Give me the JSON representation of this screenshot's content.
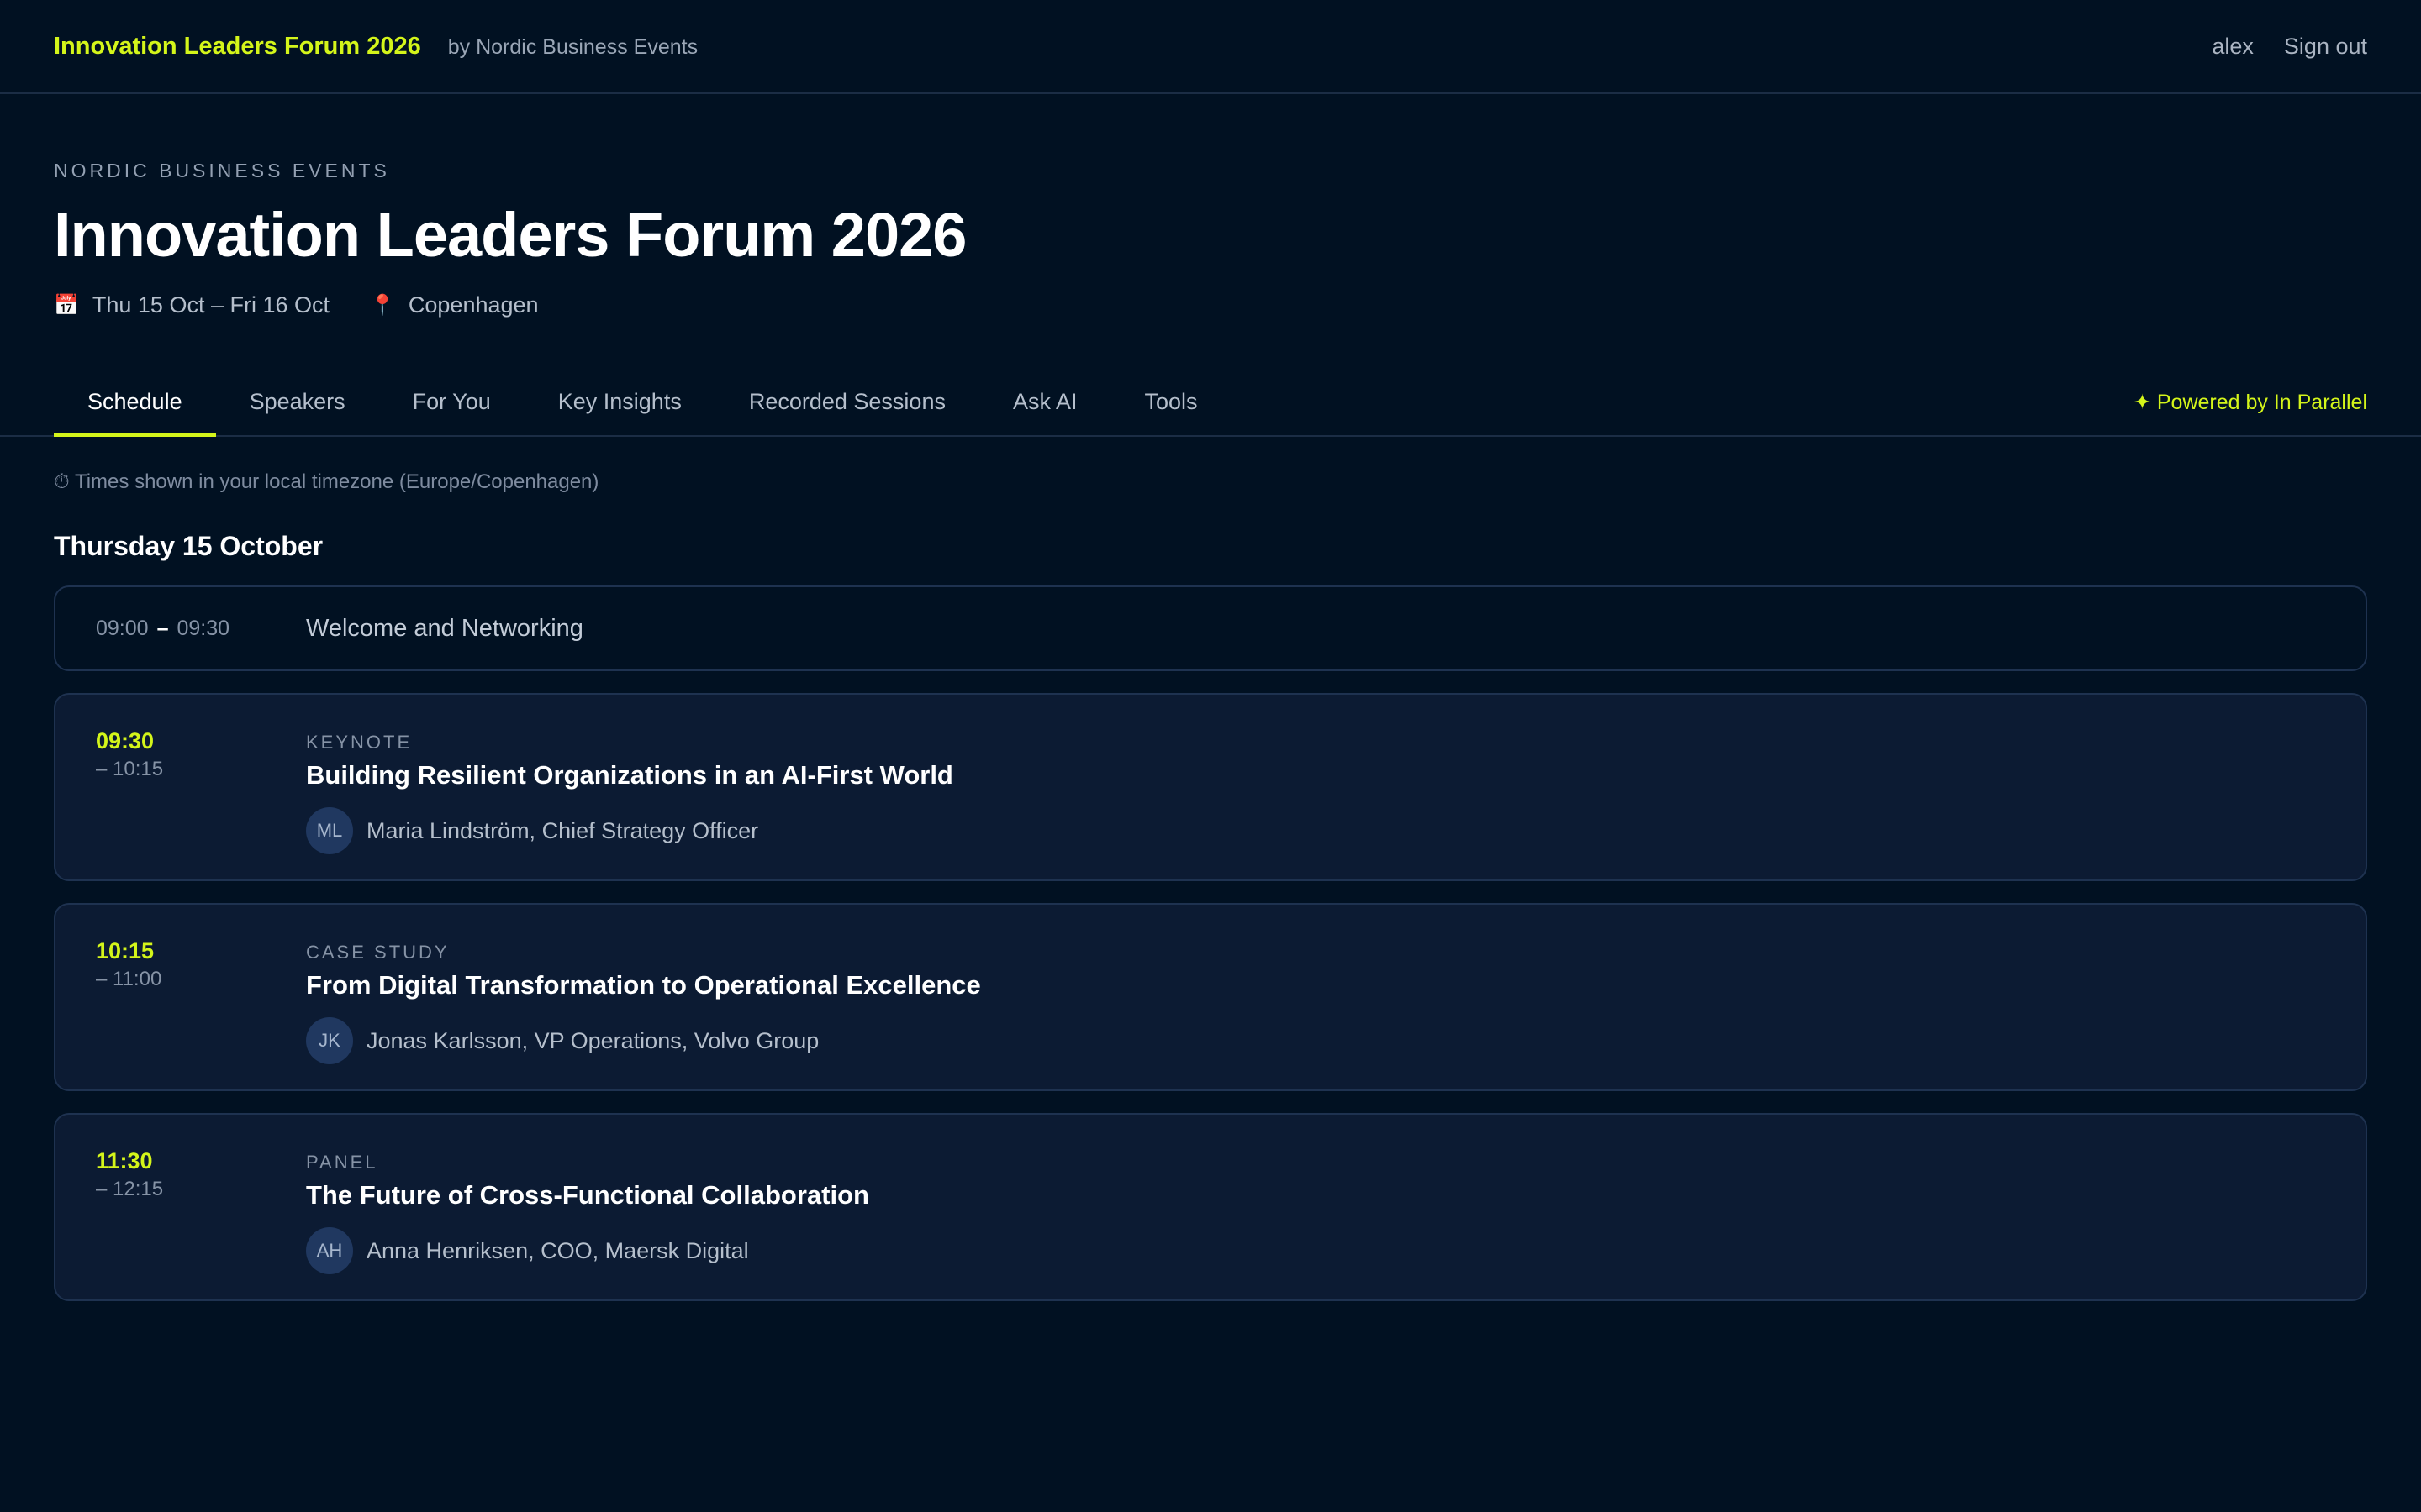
{
  "topbar": {
    "brand_title": "Innovation Leaders Forum 2026",
    "brand_by": "by Nordic Business Events",
    "username": "alex",
    "signout_label": "Sign out"
  },
  "hero": {
    "eyebrow": "NORDIC BUSINESS EVENTS",
    "title": "Innovation Leaders Forum 2026",
    "dates": "Thu 15 Oct – Fri 16 Oct",
    "location": "Copenhagen",
    "calendar_icon": "📅",
    "pin_icon": "📍"
  },
  "tabs": [
    {
      "label": "Schedule",
      "active": true
    },
    {
      "label": "Speakers"
    },
    {
      "label": "For You"
    },
    {
      "label": "Key Insights"
    },
    {
      "label": "Recorded Sessions"
    },
    {
      "label": "Ask AI"
    },
    {
      "label": "Tools"
    }
  ],
  "powered_by": "✦ Powered by In Parallel",
  "schedule": {
    "timezone_note": "⏱ Times shown in your local timezone (Europe/Copenhagen)",
    "day_heading": "Thursday 15 October",
    "welcome": {
      "start": "09:00",
      "dash": "–",
      "end": "09:30",
      "title": "Welcome and Networking"
    },
    "sessions": [
      {
        "start": "09:30",
        "end": "– 10:15",
        "type": "KEYNOTE",
        "title": "Building Resilient Organizations in an AI-First World",
        "initials": "ML",
        "speaker": "Maria Lindström, Chief Strategy Officer"
      },
      {
        "start": "10:15",
        "end": "– 11:00",
        "type": "CASE STUDY",
        "title": "From Digital Transformation to Operational Excellence",
        "initials": "JK",
        "speaker": "Jonas Karlsson, VP Operations, Volvo Group"
      },
      {
        "start": "11:30",
        "end": "– 12:15",
        "type": "PANEL",
        "title": "The Future of Cross-Functional Collaboration",
        "initials": "AH",
        "speaker": "Anna Henriksen, COO, Maersk Digital"
      }
    ]
  },
  "colors": {
    "accent": "#d4f51a",
    "background": "#011122",
    "card": "#0c1b33"
  }
}
